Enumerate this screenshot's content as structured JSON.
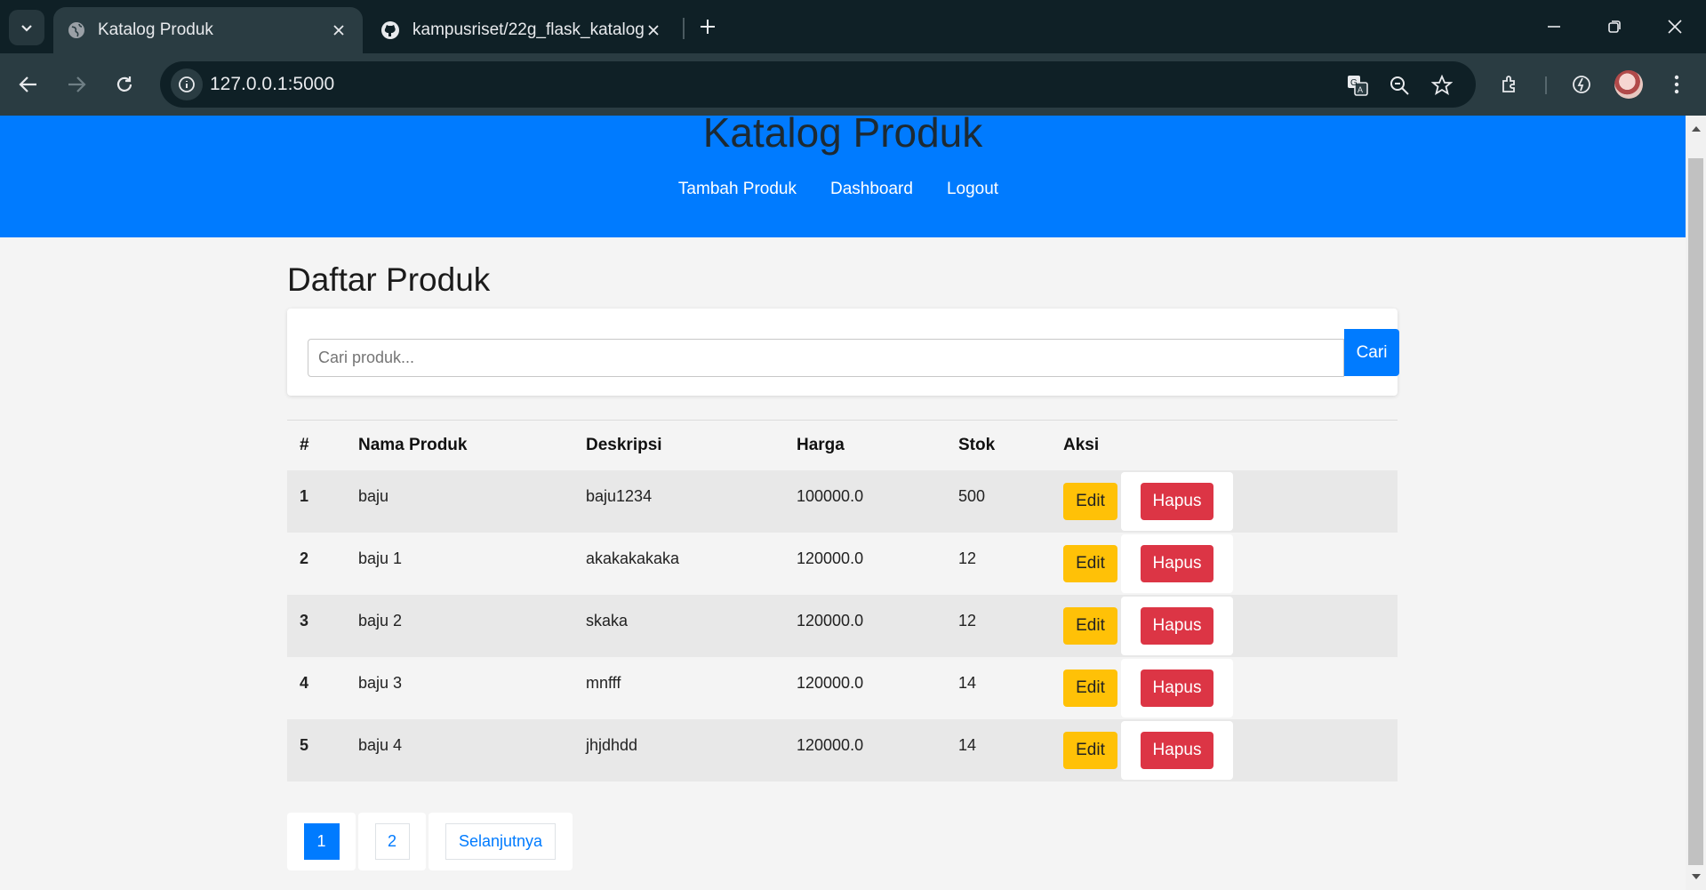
{
  "browser": {
    "tabs": [
      {
        "title": "Katalog Produk",
        "active": true
      },
      {
        "title": "kampusriset/22g_flask_katalog_",
        "active": false
      }
    ],
    "url": "127.0.0.1:5000"
  },
  "header": {
    "title": "Katalog Produk",
    "nav": [
      "Tambah Produk",
      "Dashboard",
      "Logout"
    ]
  },
  "main": {
    "title": "Daftar Produk",
    "search": {
      "placeholder": "Cari produk...",
      "value": "",
      "button": "Cari"
    },
    "table": {
      "headers": [
        "#",
        "Nama Produk",
        "Deskripsi",
        "Harga",
        "Stok",
        "Aksi"
      ],
      "rows": [
        {
          "no": "1",
          "name": "baju",
          "desc": "baju1234",
          "price": "100000.0",
          "stock": "500"
        },
        {
          "no": "2",
          "name": "baju 1",
          "desc": "akakakakaka",
          "price": "120000.0",
          "stock": "12"
        },
        {
          "no": "3",
          "name": "baju 2",
          "desc": "skaka",
          "price": "120000.0",
          "stock": "12"
        },
        {
          "no": "4",
          "name": "baju 3",
          "desc": "mnfff",
          "price": "120000.0",
          "stock": "14"
        },
        {
          "no": "5",
          "name": "baju 4",
          "desc": "jhjdhdd",
          "price": "120000.0",
          "stock": "14"
        }
      ],
      "edit_label": "Edit",
      "delete_label": "Hapus"
    },
    "pagination": {
      "pages": [
        "1",
        "2"
      ],
      "current": "1",
      "next": "Selanjutnya"
    }
  },
  "colors": {
    "primary": "#007bff",
    "warning": "#ffc107",
    "danger": "#dc3545",
    "chrome_dark": "#0f2026",
    "chrome_toolbar": "#2a3c42"
  },
  "icons": [
    "tab-search-icon",
    "globe-icon",
    "github-icon",
    "close-icon",
    "plus-icon",
    "minimize-icon",
    "restore-icon",
    "back-icon",
    "forward-icon",
    "reload-icon",
    "info-icon",
    "translate-icon",
    "zoom-out-icon",
    "star-icon",
    "extensions-icon",
    "performance-icon",
    "menu-icon"
  ]
}
